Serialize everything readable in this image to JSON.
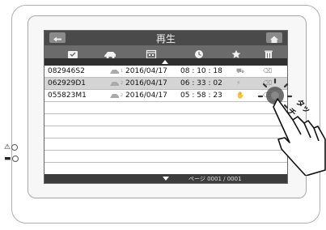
{
  "screen": {
    "title": "再生",
    "toolbar_icons": [
      "folder-icon",
      "camera-icon",
      "calendar-icon",
      "clock-icon",
      "star-icon",
      "trash-icon"
    ],
    "rows": [
      {
        "id": "082946S2",
        "cam": "1",
        "date": "2016/04/17",
        "time": "08 : 10 : 18"
      },
      {
        "id": "062929D1",
        "cam": "2",
        "date": "2016/04/17",
        "time": "06 : 33 : 02"
      },
      {
        "id": "055823M1",
        "cam": "2",
        "date": "2016/04/17",
        "time": "05 : 58 : 23"
      }
    ],
    "page_label": "ページ 0001 / 0001"
  },
  "overlay": {
    "touch_text": "タッチ"
  },
  "colors": {
    "titlebar": "#4a4a4a",
    "toolbar": "#6b6b6b",
    "selected_row": "#d4d4d4"
  }
}
